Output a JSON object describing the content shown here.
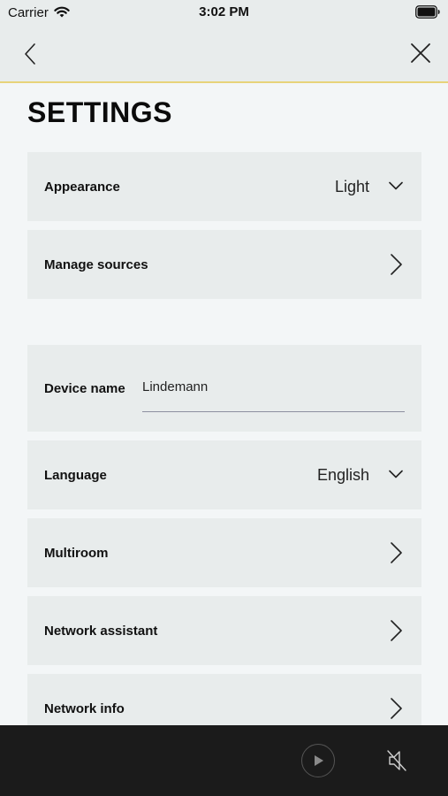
{
  "status_bar": {
    "carrier": "Carrier",
    "time": "3:02 PM",
    "icons": [
      "wifi-icon",
      "battery-icon"
    ]
  },
  "nav": {
    "icons": [
      "back-chevron-icon",
      "close-icon"
    ],
    "accent_color": "#e7d37a"
  },
  "page": {
    "title": "SETTINGS"
  },
  "settings": {
    "appearance": {
      "label": "Appearance",
      "value": "Light",
      "icon": "chevron-down-icon"
    },
    "manage_sources": {
      "label": "Manage sources",
      "icon": "chevron-right-icon"
    },
    "device_name": {
      "label": "Device name",
      "value": "Lindemann"
    },
    "language": {
      "label": "Language",
      "value": "English",
      "icon": "chevron-down-icon"
    },
    "multiroom": {
      "label": "Multiroom",
      "icon": "chevron-right-icon"
    },
    "network_assistant": {
      "label": "Network assistant",
      "icon": "chevron-right-icon"
    },
    "network_info": {
      "label": "Network info",
      "icon": "chevron-right-icon"
    }
  },
  "player": {
    "icons": [
      "play-icon",
      "mute-icon"
    ],
    "background": "#1b1b1b"
  }
}
